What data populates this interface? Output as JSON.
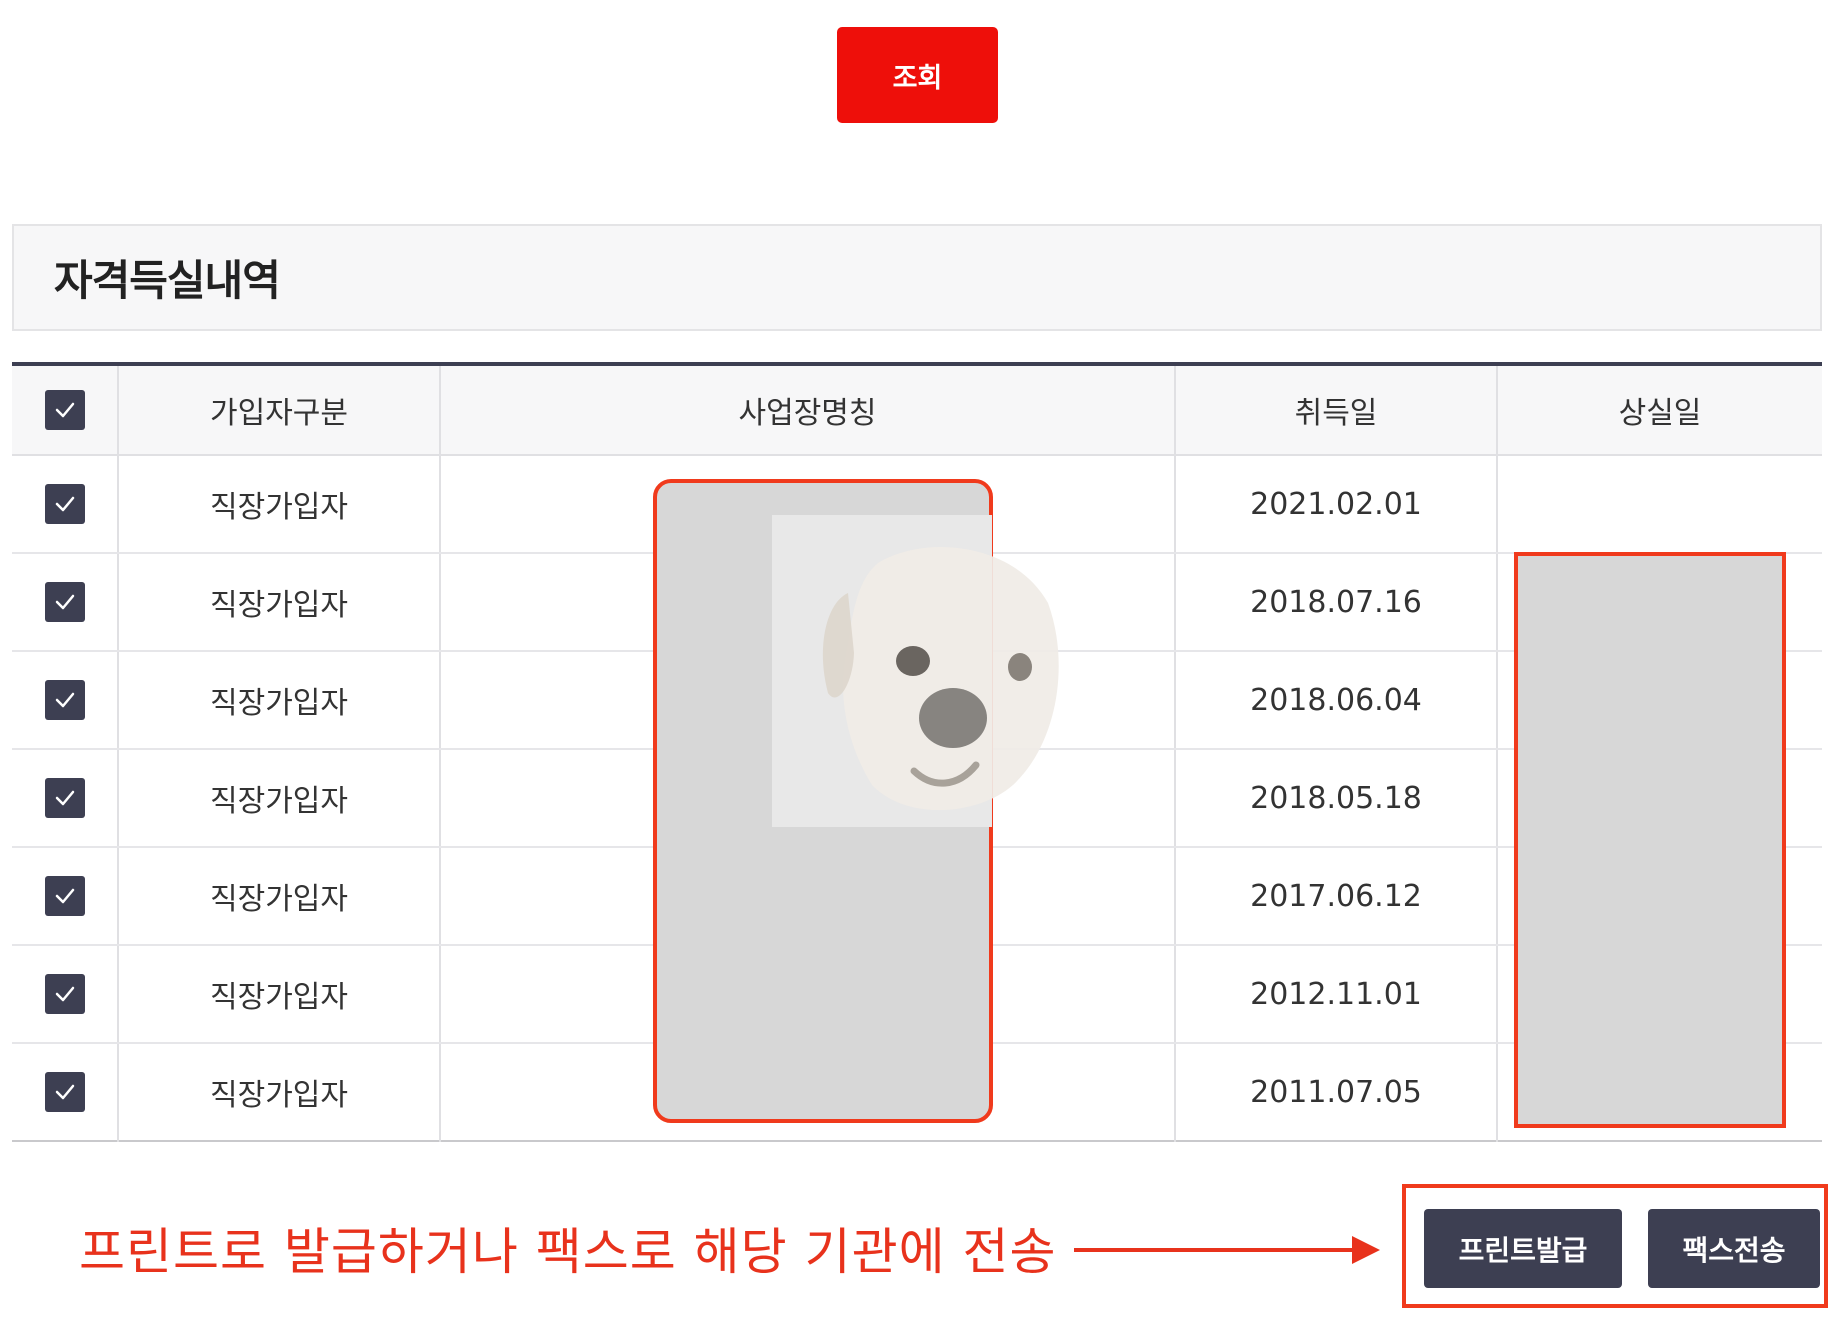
{
  "search_button": {
    "label": "조회"
  },
  "section": {
    "title": "자격득실내역"
  },
  "table": {
    "headers": {
      "type": "가입자구분",
      "workplace": "사업장명칭",
      "acquired": "취득일",
      "lost": "상실일"
    },
    "all_checked": true,
    "rows": [
      {
        "checked": true,
        "type": "직장가입자",
        "workplace": "",
        "acquired": "2021.02.01",
        "lost": ""
      },
      {
        "checked": true,
        "type": "직장가입자",
        "workplace": "",
        "acquired": "2018.07.16",
        "lost": ""
      },
      {
        "checked": true,
        "type": "직장가입자",
        "workplace": "",
        "acquired": "2018.06.04",
        "lost": ""
      },
      {
        "checked": true,
        "type": "직장가입자",
        "workplace": "",
        "acquired": "2018.05.18",
        "lost": ""
      },
      {
        "checked": true,
        "type": "직장가입자",
        "workplace": "",
        "acquired": "2017.06.12",
        "lost": ""
      },
      {
        "checked": true,
        "type": "직장가입자",
        "workplace": "",
        "acquired": "2012.11.01",
        "lost": ""
      },
      {
        "checked": true,
        "type": "직장가입자",
        "workplace": "",
        "acquired": "2011.07.05",
        "lost": ""
      }
    ]
  },
  "annotation": {
    "text": "프린트로 발급하거나 팩스로 해당 기관에 전송"
  },
  "actions": {
    "print_label": "프린트발급",
    "fax_label": "팩스전송"
  },
  "colors": {
    "search_button": "#ee0f0a",
    "checkbox": "#3d3f52",
    "action_button": "#3d3f52",
    "annotation": "#e8321c",
    "redaction": "#d7d7d7"
  }
}
